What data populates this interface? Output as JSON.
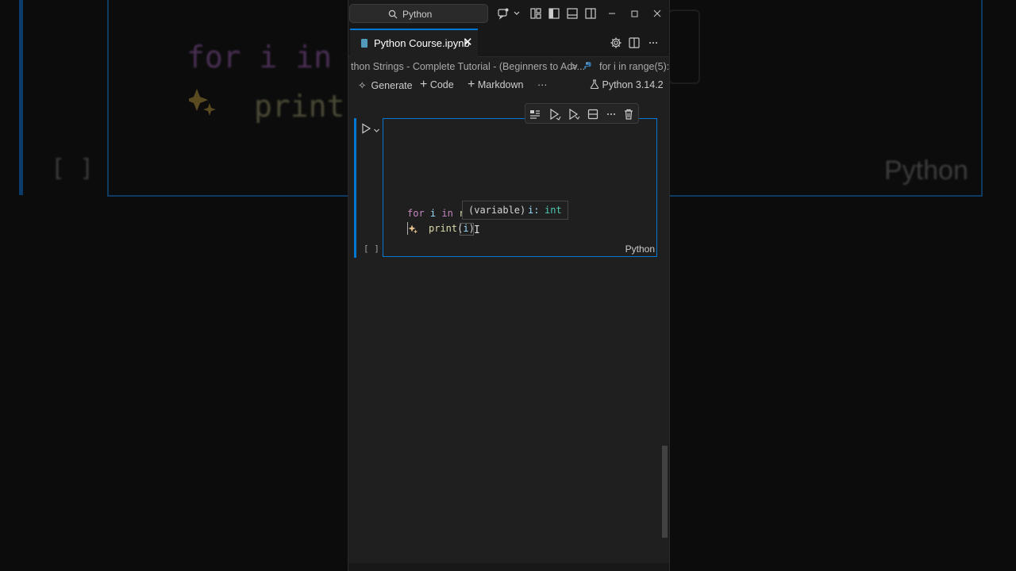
{
  "titlebar": {
    "search_text": "Python",
    "icons": [
      "search-icon",
      "copilot-icon",
      "chevron-down-icon",
      "layout-icon",
      "toggle-primary-sidebar-icon",
      "toggle-panel-icon",
      "toggle-secondary-sidebar-icon",
      "minimize-icon",
      "maximize-icon",
      "close-icon"
    ]
  },
  "tabs": [
    {
      "label": "Python Course.ipynb",
      "active": true
    }
  ],
  "tab_actions": [
    "gear-icon",
    "split-editor-icon",
    "more-icon"
  ],
  "breadcrumb": {
    "file_part": "thon Strings - Complete Tutorial - (Beginners to Adv...",
    "separator": ">",
    "symbol": "for i in range(5):"
  },
  "notebook_toolbar": {
    "generate": "Generate",
    "code": "Code",
    "markdown": "Markdown",
    "more": "···",
    "kernel": "Python 3.14.2"
  },
  "cell": {
    "exec_count": "[ ]",
    "language": "Python",
    "lines": [
      {
        "kw": "for",
        "var": "i",
        "in": "in",
        "rest": "r"
      },
      {
        "fn": "print",
        "open": "(",
        "arg": "i",
        "close": ")"
      }
    ],
    "tooltip": {
      "kind": "(variable)",
      "name": "i:",
      "type": "int"
    }
  },
  "background": {
    "line1": "for i in",
    "line2": "print",
    "exec_count": "[ ]",
    "label": "Python"
  },
  "colors": {
    "accent": "#0078d4",
    "keyword": "#c586c0",
    "variable": "#9cdcfe",
    "function": "#dcdcaa",
    "sparkle": "#e2c08d"
  }
}
